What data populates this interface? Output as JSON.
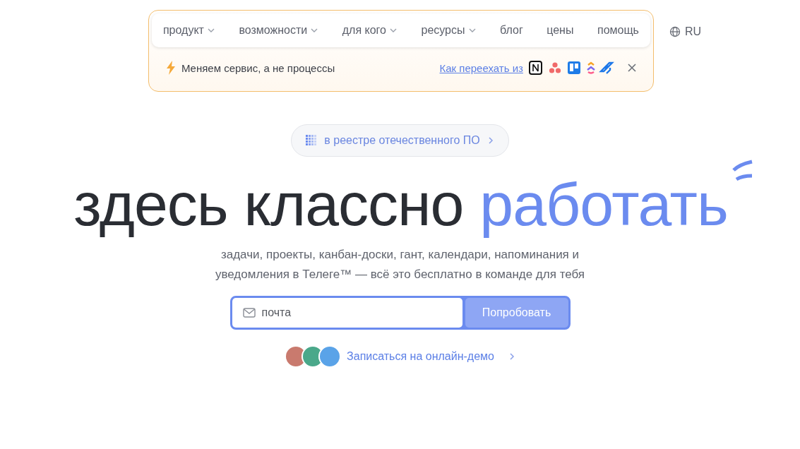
{
  "nav": {
    "items": [
      {
        "label": "продукт",
        "dropdown": true
      },
      {
        "label": "возможности",
        "dropdown": true
      },
      {
        "label": "для кого",
        "dropdown": true
      },
      {
        "label": "ресурсы",
        "dropdown": true
      },
      {
        "label": "блог",
        "dropdown": false
      },
      {
        "label": "цены",
        "dropdown": false
      },
      {
        "label": "помощь",
        "dropdown": false
      }
    ],
    "language": "RU"
  },
  "banner": {
    "text": "Меняем сервис, а не процессы",
    "link": "Как переехать из"
  },
  "registry_badge": "в реестре отечественного ПО",
  "headline": {
    "plain": "здесь классно",
    "accent": "работать"
  },
  "subtitle": "задачи, проекты, канбан-доски, гант, календари, напоминания и уведомления в Телеге™ — всё это бесплатно в команде для тебя",
  "signup": {
    "placeholder": "почта",
    "button": "Попробовать"
  },
  "demo_link": "Записаться на онлайн-демо"
}
